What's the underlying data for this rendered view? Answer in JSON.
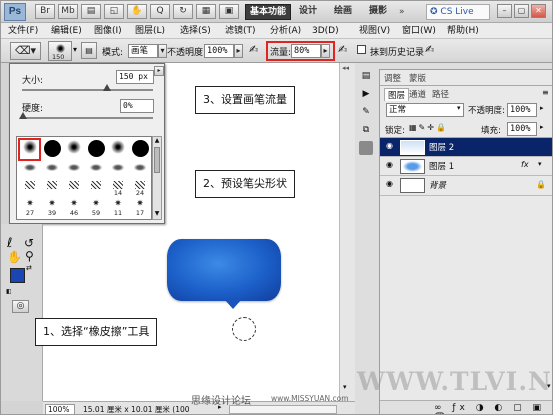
{
  "app": {
    "logo": "Ps",
    "workspaces": {
      "active": "基本功能",
      "design": "设计",
      "paint": "绘画",
      "photo": "摄影"
    },
    "cslive": "CS Live"
  },
  "menu": [
    "文件(F)",
    "编辑(E)",
    "图像(I)",
    "图层(L)",
    "选择(S)",
    "滤镜(T)",
    "分析(A)",
    "3D(D)",
    "视图(V)",
    "窗口(W)",
    "帮助(H)"
  ],
  "options": {
    "brush_size": "150",
    "mode_label": "模式:",
    "mode_value": "画笔",
    "opacity_label": "不透明度:",
    "opacity_value": "100%",
    "flow_label": "流量:",
    "flow_value": "80%",
    "history_label": "抹到历史记录"
  },
  "brush_picker": {
    "size_label": "大小:",
    "size_value": "150 px",
    "hardness_label": "硬度:",
    "hardness_value": "0%",
    "presets": [
      {
        "size": "",
        "type": "soft"
      },
      {
        "size": "",
        "type": "hard"
      },
      {
        "size": "",
        "type": "soft"
      },
      {
        "size": "",
        "type": "hard"
      },
      {
        "size": "",
        "type": "soft"
      },
      {
        "size": "",
        "type": "hard"
      },
      {
        "size": "",
        "type": "oval"
      },
      {
        "size": "",
        "type": "oval"
      },
      {
        "size": "",
        "type": "oval"
      },
      {
        "size": "",
        "type": "oval"
      },
      {
        "size": "",
        "type": "oval"
      },
      {
        "size": "",
        "type": "oval"
      },
      {
        "size": "",
        "type": "tex"
      },
      {
        "size": "",
        "type": "tex"
      },
      {
        "size": "",
        "type": "tex"
      },
      {
        "size": "",
        "type": "tex"
      },
      {
        "size": "14",
        "type": "tex"
      },
      {
        "size": "24",
        "type": "tex"
      },
      {
        "size": "27",
        "type": "star"
      },
      {
        "size": "39",
        "type": "star"
      },
      {
        "size": "46",
        "type": "star"
      },
      {
        "size": "59",
        "type": "star"
      },
      {
        "size": "11",
        "type": "star"
      },
      {
        "size": "17",
        "type": "star"
      }
    ]
  },
  "callouts": {
    "flow": "3、设置画笔流量",
    "tip": "2、预设笔尖形状",
    "eraser": "1、选择“橡皮擦”工具"
  },
  "colors": {
    "accent_red": "#e1241f",
    "shape_blue": "#1f5fc8",
    "fg_swatch": "#1b45b2",
    "selected_layer": "#0a246a"
  },
  "layers_panel": {
    "tabs": [
      "调整",
      "蒙版"
    ],
    "subtabs": [
      "图层",
      "通道",
      "路径"
    ],
    "blend_mode": "正常",
    "opacity_label": "不透明度:",
    "opacity_value": "100%",
    "lock_label": "锁定:",
    "fill_label": "填充:",
    "fill_value": "100%",
    "layers": [
      {
        "name": "图层 2",
        "selected": true
      },
      {
        "name": "图层 1",
        "selected": false
      },
      {
        "name": "背景",
        "selected": false
      }
    ],
    "fx": "fx"
  },
  "status": {
    "zoom": "100%",
    "doc": "15.01 厘米 x 10.01 厘米 (100"
  },
  "watermark": {
    "site_cn": "思缘设计论坛",
    "site_url": "www.MISSYUAN.com",
    "tlvi": "WWW.TLVI.NET"
  }
}
